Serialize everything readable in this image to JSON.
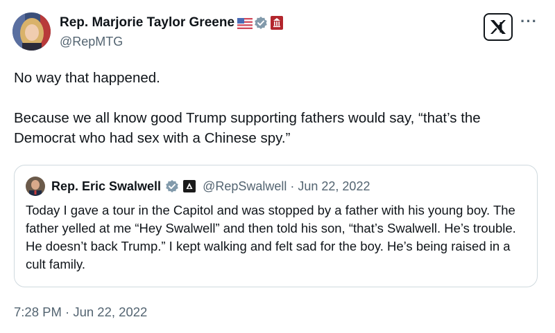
{
  "author": {
    "display_name": "Rep. Marjorie Taylor Greene",
    "handle": "@RepMTG",
    "badges": [
      "us-flag-icon",
      "verified-gray-icon",
      "government-label-icon"
    ]
  },
  "tweet": {
    "text": "No way that happened.\n\nBecause we all know good Trump supporting fathers would say, “that’s the Democrat who had sex with a Chinese spy.”",
    "timestamp": "7:28 PM · Jun 22, 2022"
  },
  "quoted_tweet": {
    "display_name": "Rep. Eric Swalwell",
    "handle_date": "@RepSwalwell · Jun 22, 2022",
    "text": "Today I gave a tour in the Capitol and was stopped by a father with his young boy. The father yelled at me “Hey Swalwell” and then told his son, “that’s Swalwell. He’s trouble. He doesn’t back Trump.” I kept walking and felt sad for the boy. He’s being raised in a cult family."
  },
  "toolbar": {
    "more_label": "···"
  },
  "colors": {
    "text_primary": "#0f1419",
    "text_secondary": "#536471",
    "border": "#cfd9de",
    "verified_gray": "#829aab",
    "gov_red": "#b3262d"
  }
}
